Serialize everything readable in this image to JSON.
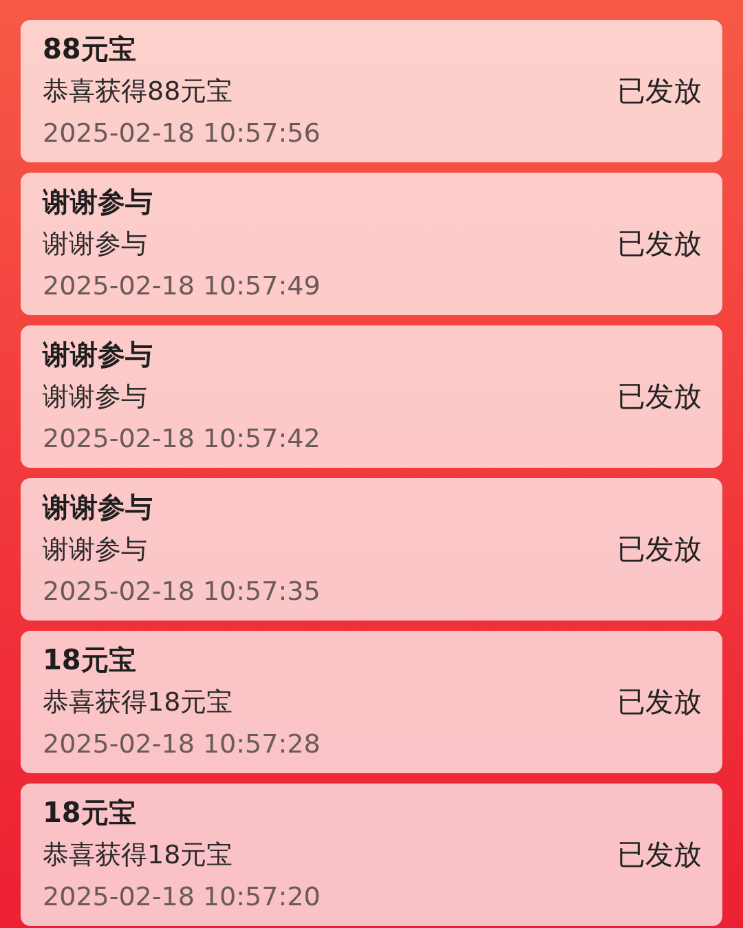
{
  "records": [
    {
      "title": "88元宝",
      "description": "恭喜获得88元宝",
      "time": "2025-02-18 10:57:56",
      "status": "已发放"
    },
    {
      "title": "谢谢参与",
      "description": "谢谢参与",
      "time": "2025-02-18 10:57:49",
      "status": "已发放"
    },
    {
      "title": "谢谢参与",
      "description": "谢谢参与",
      "time": "2025-02-18 10:57:42",
      "status": "已发放"
    },
    {
      "title": "谢谢参与",
      "description": "谢谢参与",
      "time": "2025-02-18 10:57:35",
      "status": "已发放"
    },
    {
      "title": "18元宝",
      "description": "恭喜获得18元宝",
      "time": "2025-02-18 10:57:28",
      "status": "已发放"
    },
    {
      "title": "18元宝",
      "description": "恭喜获得18元宝",
      "time": "2025-02-18 10:57:20",
      "status": "已发放"
    }
  ]
}
